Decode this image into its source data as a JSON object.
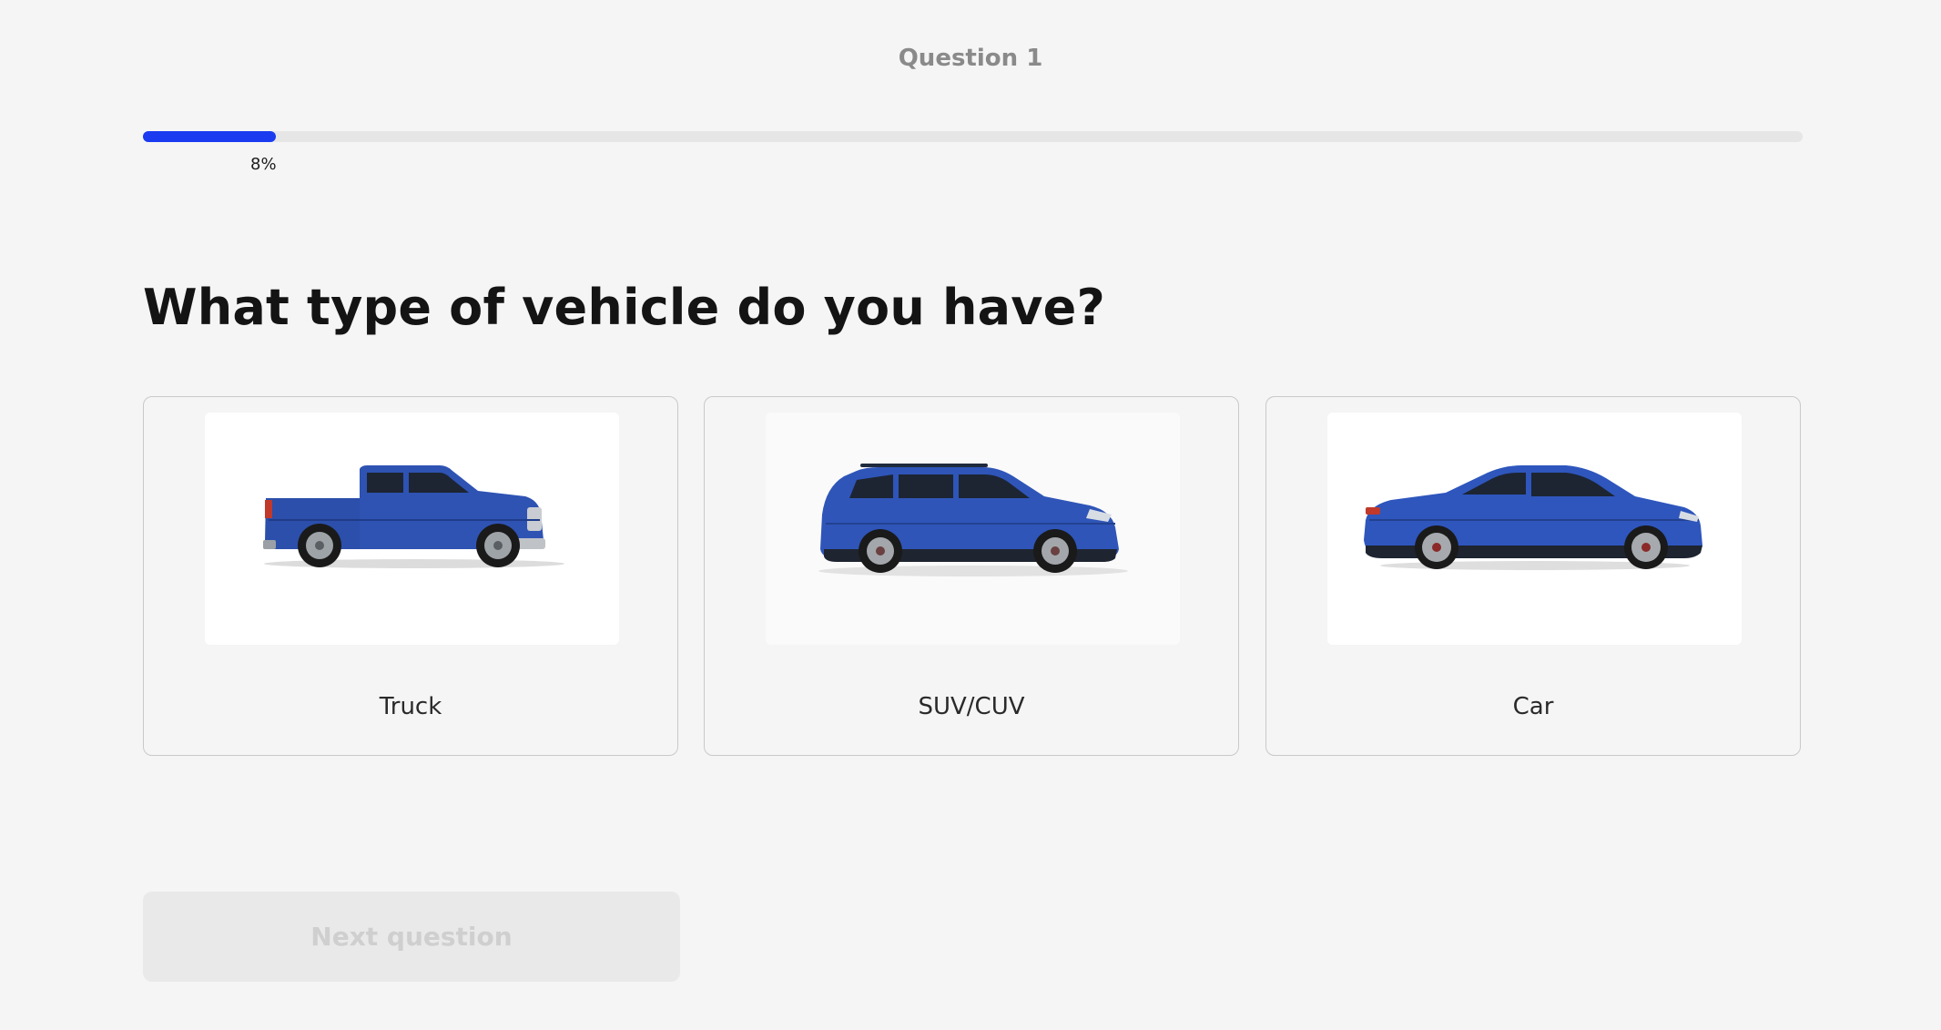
{
  "header": {
    "question_label": "Question 1"
  },
  "progress": {
    "value_percent": 8,
    "label": "8%",
    "fill_color": "#1a3bf0",
    "track_color": "#e6e6e6"
  },
  "question": {
    "title": "What type of vehicle do you have?"
  },
  "options": [
    {
      "label": "Truck",
      "icon": "pickup-truck-image"
    },
    {
      "label": "SUV/CUV",
      "icon": "suv-image"
    },
    {
      "label": "Car",
      "icon": "sedan-image"
    }
  ],
  "footer": {
    "next_label": "Next question"
  },
  "colors": {
    "background": "#f5f5f5",
    "vehicle_blue": "#2a4fb5"
  }
}
